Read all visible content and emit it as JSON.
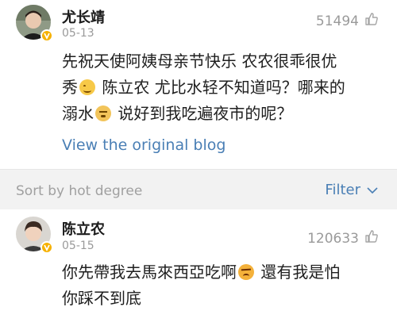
{
  "comments": [
    {
      "username": "尤长靖",
      "date": "05-13",
      "likes": "51494",
      "text_line1": "先祝天使阿姨母亲节快乐 农农很乖很优",
      "text_line2a": "秀",
      "text_line2b": "陈立农 尤比水轻不知道吗？哪来的",
      "text_line3a": "溺水",
      "text_line3b": "说好到我吃遍夜市的呢？",
      "link_label": "View the original blog"
    },
    {
      "username": "陈立农",
      "date": "05-15",
      "likes": "120633",
      "text_line1a": "你先帶我去馬來西亞吃啊",
      "text_line1b": "還有我是怕",
      "text_line2": "你踩不到底"
    }
  ],
  "sort_bar": {
    "label": "Sort by hot degree",
    "filter_label": "Filter"
  },
  "icons": {
    "like": "thumbs-up-icon",
    "badge": "verified-v-icon",
    "chevron": "chevron-down-icon"
  },
  "colors": {
    "link": "#4a7fb5",
    "muted": "#9a9a9a",
    "badge": "#f6b100",
    "sort_bg": "#f2f2f2"
  }
}
